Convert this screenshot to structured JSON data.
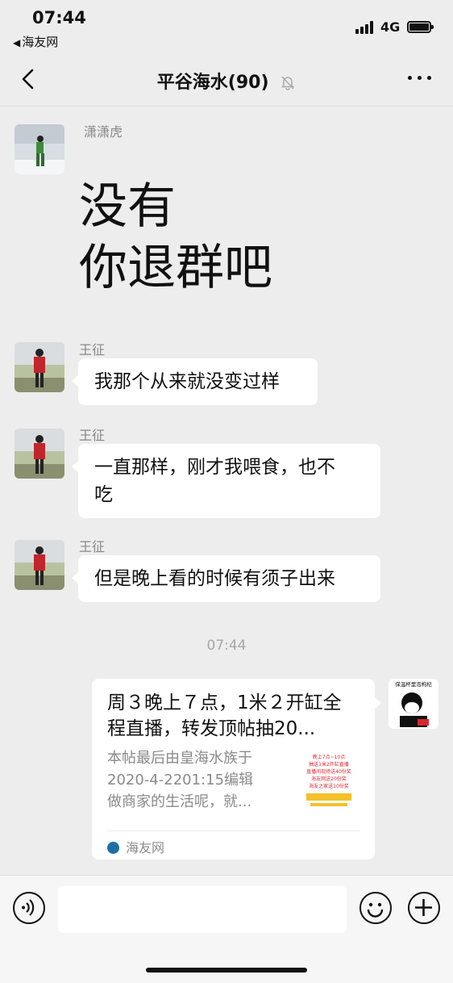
{
  "status_bar": {
    "time": "07:44",
    "back_app": "海友网",
    "network": "4G"
  },
  "nav": {
    "title": "平谷海水(90)"
  },
  "messages": [
    {
      "sender": "潇潇虎",
      "line1": "没有",
      "line2": "你退群吧"
    },
    {
      "sender": "王征",
      "text": "我那个从来就没变过样"
    },
    {
      "sender": "王征",
      "line1": "一直那样，刚才我喂食，也不",
      "line2": "吃"
    },
    {
      "sender": "王征",
      "text": "但是晚上看的时候有须子出来"
    }
  ],
  "timestamp": "07:44",
  "link_card": {
    "title_line1": "周３晚上７点，1米２开缸全",
    "title_line2": "程直播，转发顶帖抽20...",
    "desc_line1": "本帖最后由皇海水族于",
    "desc_line2": "2020-4-2201:15编辑",
    "desc_line3": "做商家的生活呢，就...",
    "thumb_text": [
      "晚上7点~10点",
      "抽送1米2开缸直播",
      "直播间现场送40份奖",
      "海友网送20份奖",
      "海友之家送10份奖"
    ],
    "source": "海友网"
  },
  "my_avatar_caption": "保温杯里泡枸杞",
  "colors": {
    "background": "#ededed",
    "bubble": "#ffffff",
    "muted_text": "#888888"
  }
}
